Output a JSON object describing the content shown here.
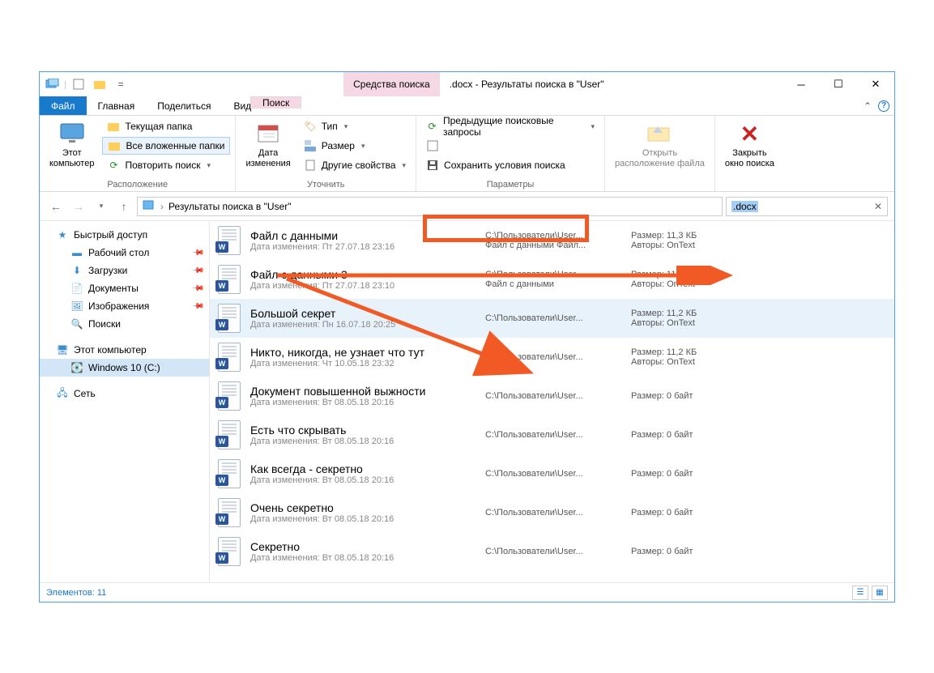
{
  "titlebar": {
    "search_tools": "Средства поиска",
    "title": ".docx - Результаты поиска в \"User\""
  },
  "tabs": {
    "file": "Файл",
    "home": "Главная",
    "share": "Поделиться",
    "view": "Вид",
    "search": "Поиск"
  },
  "ribbon": {
    "location": {
      "this_pc": "Этот\nкомпьютер",
      "current_folder": "Текущая папка",
      "all_subfolders": "Все вложенные папки",
      "search_again": "Повторить поиск",
      "group": "Расположение"
    },
    "refine": {
      "date": "Дата\nизменения",
      "type": "Тип",
      "size": "Размер",
      "other": "Другие свойства",
      "group": "Уточнить"
    },
    "options": {
      "recent": "Предыдущие поисковые запросы",
      "save": "Сохранить условия поиска",
      "group": "Параметры"
    },
    "open_loc": "Открыть\nрасположение файла",
    "close": "Закрыть\nокно поиска"
  },
  "address": {
    "path": "Результаты поиска в \"User\"",
    "search_value": ".docx"
  },
  "sidebar": {
    "quick_access": "Быстрый доступ",
    "desktop": "Рабочий стол",
    "downloads": "Загрузки",
    "documents": "Документы",
    "pictures": "Изображения",
    "searches": "Поиски",
    "this_pc": "Этот компьютер",
    "drive_c": "Windows 10 (C:)",
    "network": "Сеть"
  },
  "files": [
    {
      "name": "Файл с данными",
      "date_label": "Дата изменения:",
      "date": "Пт 27.07.18 23:16",
      "path": "C:\\Пользователи\\User...",
      "path2": "Файл с данными Файл...",
      "size_label": "Размер:",
      "size": "11,3 КБ",
      "auth_label": "Авторы:",
      "auth": "OnText"
    },
    {
      "name": "Файл с данными 3",
      "date_label": "Дата изменения:",
      "date": "Пт 27.07.18 23:10",
      "path": "C:\\Пользователи\\User...",
      "path2": "Файл с данными",
      "size_label": "Размер:",
      "size": "11,1 КБ",
      "auth_label": "Авторы:",
      "auth": "OnText"
    },
    {
      "name": "Большой секрет",
      "date_label": "Дата изменения:",
      "date": "Пн 16.07.18 20:25",
      "path": "C:\\Пользователи\\User...",
      "path2": "",
      "size_label": "Размер:",
      "size": "11,2 КБ",
      "auth_label": "Авторы:",
      "auth": "OnText",
      "selected": true
    },
    {
      "name": "Никто, никогда, не узнает что тут",
      "date_label": "Дата изменения:",
      "date": "Чт 10.05.18 23:32",
      "path": "C:\\Пользователи\\User...",
      "path2": "",
      "size_label": "Размер:",
      "size": "11,2 КБ",
      "auth_label": "Авторы:",
      "auth": "OnText"
    },
    {
      "name": "Документ повышенной выжности",
      "date_label": "Дата изменения:",
      "date": "Вт 08.05.18 20:16",
      "path": "C:\\Пользователи\\User...",
      "path2": "",
      "size_label": "Размер:",
      "size": "0 байт",
      "auth_label": "",
      "auth": ""
    },
    {
      "name": "Есть что скрывать",
      "date_label": "Дата изменения:",
      "date": "Вт 08.05.18 20:16",
      "path": "C:\\Пользователи\\User...",
      "path2": "",
      "size_label": "Размер:",
      "size": "0 байт",
      "auth_label": "",
      "auth": ""
    },
    {
      "name": "Как всегда - секретно",
      "date_label": "Дата изменения:",
      "date": "Вт 08.05.18 20:16",
      "path": "C:\\Пользователи\\User...",
      "path2": "",
      "size_label": "Размер:",
      "size": "0 байт",
      "auth_label": "",
      "auth": ""
    },
    {
      "name": "Очень секретно",
      "date_label": "Дата изменения:",
      "date": "Вт 08.05.18 20:16",
      "path": "C:\\Пользователи\\User...",
      "path2": "",
      "size_label": "Размер:",
      "size": "0 байт",
      "auth_label": "",
      "auth": ""
    },
    {
      "name": "Секретно",
      "date_label": "Дата изменения:",
      "date": "Вт 08.05.18 20:16",
      "path": "C:\\Пользователи\\User...",
      "path2": "",
      "size_label": "Размер:",
      "size": "0 байт",
      "auth_label": "",
      "auth": ""
    }
  ],
  "status": {
    "count_label": "Элементов:",
    "count": "11"
  }
}
